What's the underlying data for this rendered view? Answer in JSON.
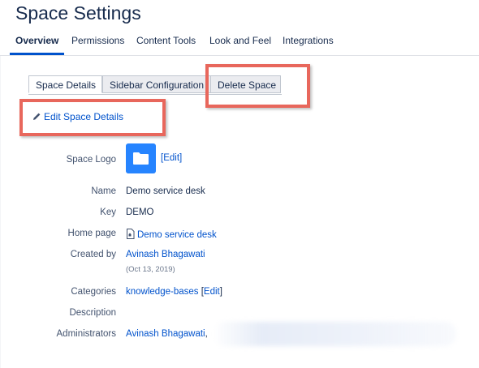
{
  "page": {
    "title": "Space Settings"
  },
  "top_nav": {
    "tabs": [
      {
        "label": "Overview",
        "active": true
      },
      {
        "label": "Permissions"
      },
      {
        "label": "Content Tools"
      },
      {
        "label": "Look and Feel"
      },
      {
        "label": "Integrations"
      }
    ]
  },
  "sub_tabs": [
    {
      "label": "Space Details",
      "active": true
    },
    {
      "label": "Sidebar Configuration"
    },
    {
      "label": "Delete Space"
    }
  ],
  "edit_space_details": "Edit Space Details",
  "details": {
    "space_logo_label": "Space Logo",
    "logo_edit": "[Edit]",
    "name_label": "Name",
    "name_value": "Demo service desk",
    "key_label": "Key",
    "key_value": "DEMO",
    "home_page_label": "Home page",
    "home_page_value": "Demo service desk",
    "created_by_label": "Created by",
    "created_by_value": "Avinash Bhagawati",
    "created_date": "(Oct 13, 2019)",
    "categories_label": "Categories",
    "categories_value": "knowledge-bases",
    "categories_edit_open": "[",
    "categories_edit": "Edit",
    "categories_edit_close": "]",
    "description_label": "Description",
    "administrators_label": "Administrators",
    "administrators_value": "Avinash Bhagawati",
    "administrators_sep": ","
  },
  "icons": {
    "edit": "pencil-icon",
    "logo": "folder-icon",
    "home_page": "page-icon"
  },
  "colors": {
    "link": "#0052cc",
    "highlight": "#e8675c",
    "logo_bg": "#2684ff",
    "active_tab_underline": "#0052cc"
  }
}
